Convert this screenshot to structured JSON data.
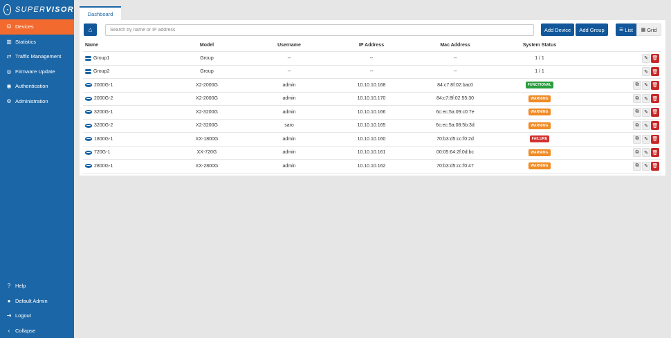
{
  "brand": {
    "part1": "SUPER",
    "part2": "VISOR",
    "logo_glyph": "◔"
  },
  "sidebar": {
    "items": [
      {
        "label": "Devices",
        "icon": "devices-icon",
        "glyph": "⛁",
        "active": true
      },
      {
        "label": "Statistics",
        "icon": "chart-icon",
        "glyph": "▥",
        "active": false
      },
      {
        "label": "Traffic Management",
        "icon": "traffic-icon",
        "glyph": "⇄",
        "active": false
      },
      {
        "label": "Firmware Update",
        "icon": "firmware-icon",
        "glyph": "◎",
        "active": false
      },
      {
        "label": "Authentication",
        "icon": "user-circle-icon",
        "glyph": "◉",
        "active": false
      },
      {
        "label": "Administration",
        "icon": "gear-icon",
        "glyph": "⚙",
        "active": false
      }
    ],
    "bottom": [
      {
        "label": "Help",
        "icon": "help-icon",
        "glyph": "?"
      },
      {
        "label": "Default Admin",
        "icon": "user-icon",
        "glyph": "●"
      },
      {
        "label": "Logout",
        "icon": "logout-icon",
        "glyph": "⇥"
      },
      {
        "label": "Collapse",
        "icon": "chevron-left-icon",
        "glyph": "‹"
      }
    ]
  },
  "tab": {
    "label": "Dashboard"
  },
  "toolbar": {
    "home_glyph": "⌂",
    "search_placeholder": "Search by name or IP address",
    "add_device": "Add Device",
    "add_group": "Add Group",
    "list_label": "List",
    "grid_label": "Grid",
    "list_glyph": "☰",
    "grid_glyph": "▦"
  },
  "table": {
    "headers": [
      "Name",
      "Model",
      "Username",
      "IP Address",
      "Mac Address",
      "System Status"
    ],
    "rows": [
      {
        "type": "group",
        "name": "Group1",
        "model": "Group",
        "username": "--",
        "ip": "--",
        "mac": "--",
        "status": "1 / 1",
        "status_kind": "text"
      },
      {
        "type": "group",
        "name": "Group2",
        "model": "Group",
        "username": "--",
        "ip": "--",
        "mac": "--",
        "status": "1 / 1",
        "status_kind": "text"
      },
      {
        "type": "device",
        "name": "2000G-1",
        "model": "X2-2000G",
        "username": "admin",
        "ip": "10.10.10.168",
        "mac": "84:c7:8f:02:bac0",
        "status": "FUNCTIONAL",
        "status_kind": "ok"
      },
      {
        "type": "device",
        "name": "2000G-2",
        "model": "X2-2000G",
        "username": "admin",
        "ip": "10.10.10.170",
        "mac": "84:c7:8f:02:55:30",
        "status": "WARNING",
        "status_kind": "warn"
      },
      {
        "type": "device",
        "name": "3200G-1",
        "model": "X2-3200G",
        "username": "admin",
        "ip": "10.10.10.166",
        "mac": "6c:ec:5a:09:c0:7e",
        "status": "WARNING",
        "status_kind": "warn"
      },
      {
        "type": "device",
        "name": "3200G-2",
        "model": "X2-3200G",
        "username": "saro",
        "ip": "10.10.10.165",
        "mac": "6c:ec:5a:08:5b:3d",
        "status": "WARNING",
        "status_kind": "warn"
      },
      {
        "type": "device",
        "name": "1800G-1",
        "model": "XX-1800G",
        "username": "admin",
        "ip": "10.10.10.160",
        "mac": "70:b3:d5:cc:f0:2d",
        "status": "FAILURE",
        "status_kind": "fail"
      },
      {
        "type": "device",
        "name": "720G-1",
        "model": "XX-720G",
        "username": "admin",
        "ip": "10.10.10.161",
        "mac": "00:05:64:2f:0d:bc",
        "status": "WARNING",
        "status_kind": "warn"
      },
      {
        "type": "device",
        "name": "2800G-1",
        "model": "XX-2800G",
        "username": "admin",
        "ip": "10.10.10.162",
        "mac": "70:b3:d5:cc:f0:47",
        "status": "WARNING",
        "status_kind": "warn"
      }
    ]
  },
  "actions": {
    "open_glyph": "⧉",
    "edit_glyph": "✎",
    "delete_glyph": "🗑"
  }
}
